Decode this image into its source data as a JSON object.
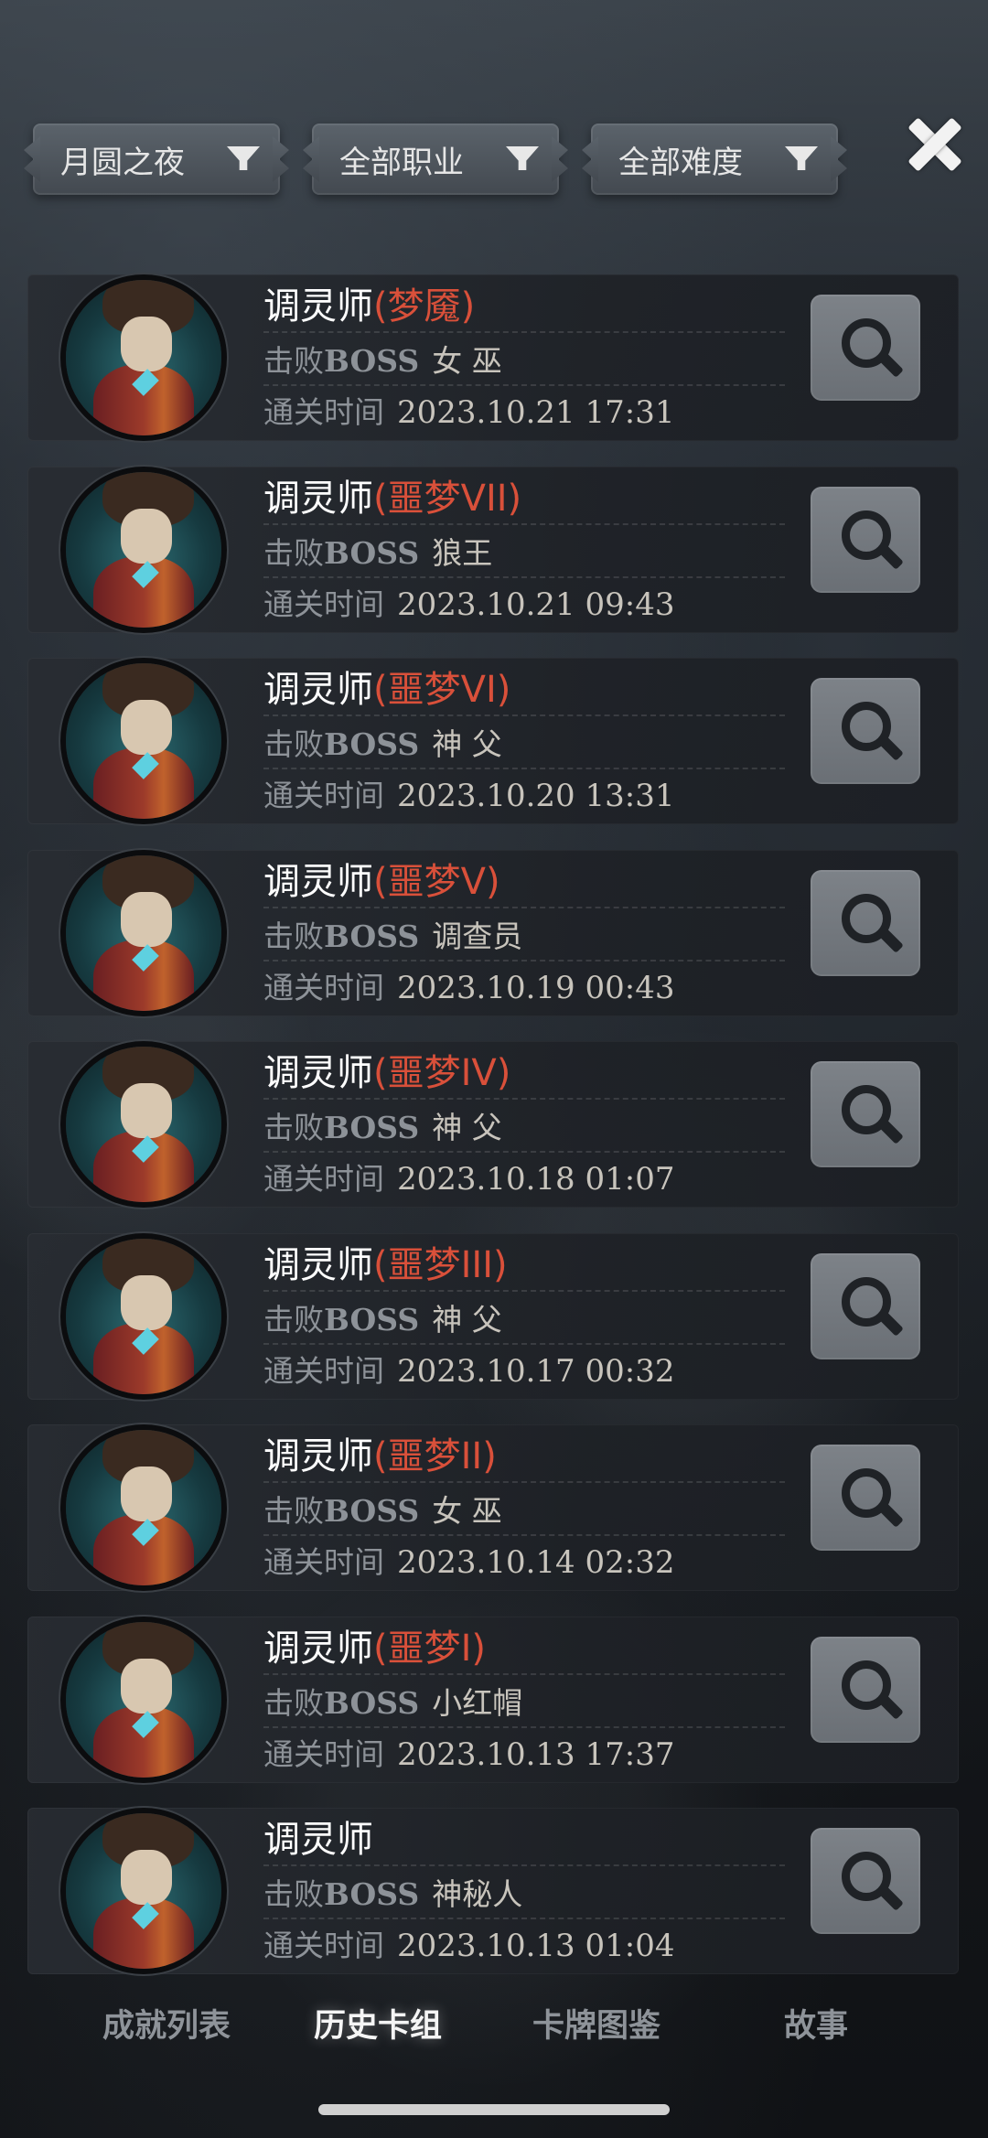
{
  "filters": [
    {
      "label": "月圆之夜"
    },
    {
      "label": "全部职业"
    },
    {
      "label": "全部难度"
    }
  ],
  "labels": {
    "defeat": "击败",
    "boss": "BOSS",
    "clear_time": "通关时间"
  },
  "records": [
    {
      "name": "调灵师",
      "difficulty": "(梦魇)",
      "boss": "女 巫",
      "time": "2023.10.21 17:31"
    },
    {
      "name": "调灵师",
      "difficulty": "(噩梦VII)",
      "boss": "狼王",
      "time": "2023.10.21 09:43"
    },
    {
      "name": "调灵师",
      "difficulty": "(噩梦VI)",
      "boss": "神 父",
      "time": "2023.10.20 13:31"
    },
    {
      "name": "调灵师",
      "difficulty": "(噩梦V)",
      "boss": "调查员",
      "time": "2023.10.19 00:43"
    },
    {
      "name": "调灵师",
      "difficulty": "(噩梦IV)",
      "boss": "神 父",
      "time": "2023.10.18 01:07"
    },
    {
      "name": "调灵师",
      "difficulty": "(噩梦III)",
      "boss": "神 父",
      "time": "2023.10.17 00:32"
    },
    {
      "name": "调灵师",
      "difficulty": "(噩梦II)",
      "boss": "女 巫",
      "time": "2023.10.14 02:32"
    },
    {
      "name": "调灵师",
      "difficulty": "(噩梦I)",
      "boss": "小红帽",
      "time": "2023.10.13 17:37"
    },
    {
      "name": "调灵师",
      "difficulty": "",
      "boss": "神秘人",
      "time": "2023.10.13 01:04"
    }
  ],
  "tabs": [
    {
      "label": "成就列表",
      "active": false
    },
    {
      "label": "历史卡组",
      "active": true
    },
    {
      "label": "卡牌图鉴",
      "active": false
    },
    {
      "label": "故事",
      "active": false
    }
  ],
  "colors": {
    "difficulty": "#d9503a",
    "name": "#ffffff",
    "muted": "#8d9298"
  }
}
